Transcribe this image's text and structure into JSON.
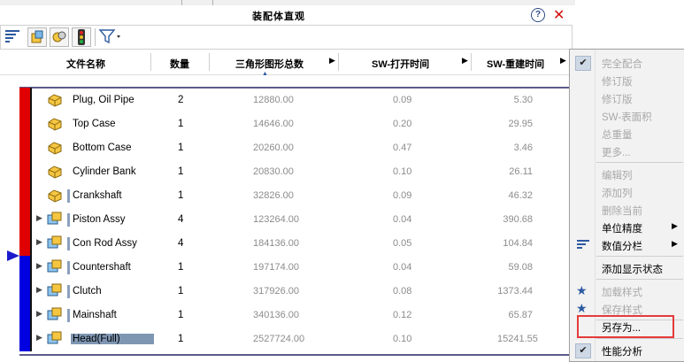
{
  "window": {
    "title": "装配体直观"
  },
  "columns": {
    "name": "文件名称",
    "qty": "数量",
    "triangles": "三角形图形总数",
    "open_time": "SW-打开时间",
    "rebuild_time": "SW-重建时间"
  },
  "rows": [
    {
      "name": "Plug, Oil Pipe",
      "qty": "2",
      "triangles": "12880.00",
      "open": "0.09",
      "rebuild": "5.30"
    },
    {
      "name": "Top Case",
      "qty": "1",
      "triangles": "14646.00",
      "open": "0.20",
      "rebuild": "29.95"
    },
    {
      "name": "Bottom Case",
      "qty": "1",
      "triangles": "20260.00",
      "open": "0.47",
      "rebuild": "3.46"
    },
    {
      "name": "Cylinder Bank",
      "qty": "1",
      "triangles": "20830.00",
      "open": "0.10",
      "rebuild": "26.11"
    },
    {
      "name": "Crankshaft",
      "qty": "1",
      "triangles": "32826.00",
      "open": "0.09",
      "rebuild": "46.32"
    },
    {
      "name": "Piston Assy",
      "qty": "4",
      "triangles": "123264.00",
      "open": "0.04",
      "rebuild": "390.68"
    },
    {
      "name": "Con Rod Assy",
      "qty": "4",
      "triangles": "184136.00",
      "open": "0.05",
      "rebuild": "104.84"
    },
    {
      "name": "Countershaft",
      "qty": "1",
      "triangles": "197174.00",
      "open": "0.04",
      "rebuild": "59.08"
    },
    {
      "name": "Clutch",
      "qty": "1",
      "triangles": "317926.00",
      "open": "0.08",
      "rebuild": "1373.44"
    },
    {
      "name": "Mainshaft",
      "qty": "1",
      "triangles": "340136.00",
      "open": "0.12",
      "rebuild": "65.87"
    },
    {
      "name": "Head(Full)",
      "qty": "1",
      "triangles": "2527724.00",
      "open": "0.10",
      "rebuild": "15241.55"
    }
  ],
  "menu": {
    "full_match": "完全配合",
    "revision1": "修订版",
    "revision2": "修订版",
    "surface_area": "SW-表面积",
    "total_weight": "总重量",
    "more": "更多...",
    "edit_column": "编辑列",
    "add_column": "添加列",
    "delete_current": "删除当前",
    "unit_precision": "单位精度",
    "value_bins": "数值分栏",
    "add_display_state": "添加显示状态",
    "load_style": "加载样式",
    "save_style": "保存样式",
    "save_as": "另存为...",
    "perf_analysis": "性能分析"
  },
  "icons": {
    "help": "?",
    "close": "✕",
    "check": "✔"
  },
  "colors": {
    "red_bar": "#e00000",
    "blue_bar": "#0000e0",
    "highlight_box": "#e53b3b"
  }
}
